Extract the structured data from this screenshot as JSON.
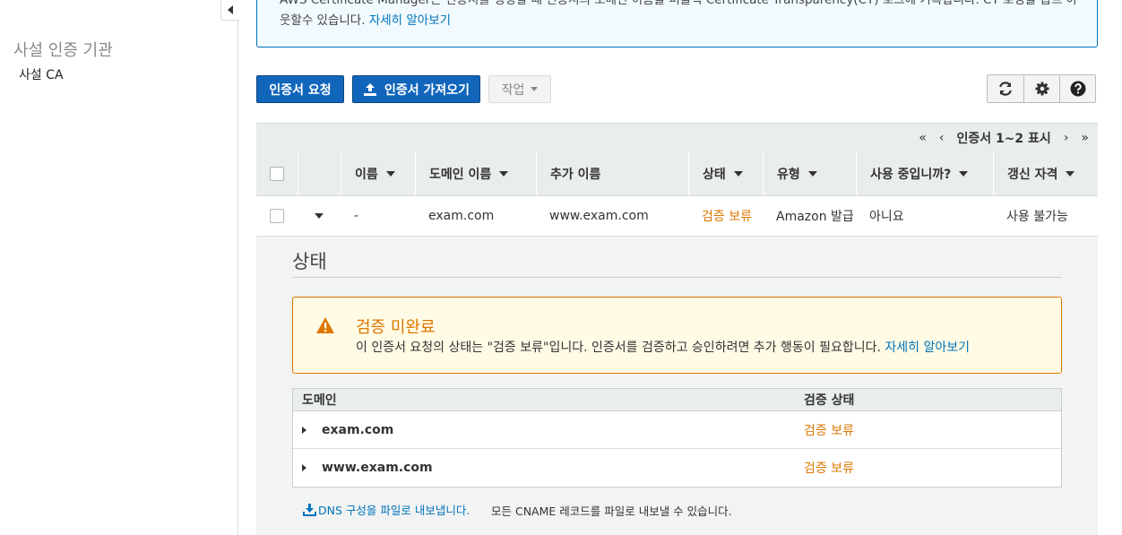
{
  "sidebar": {
    "heading": "사설 인증 기관",
    "items": [
      {
        "label": "사설 CA"
      }
    ]
  },
  "banner": {
    "line1": "AWS Certificate Manager는 인증서를 생성할 때 인증서의 도메인 이름을 퍼블릭 Certificate Transparency(CT) 로그에 기록합니다. CT 로깅을 옵트 아",
    "line2": "웃할수 있습니다.",
    "link": "자세히 알아보기"
  },
  "toolbar": {
    "request_label": "인증서 요청",
    "import_label": "인증서 가져오기",
    "actions_label": "작업",
    "icons": [
      "refresh-icon",
      "gear-icon",
      "help-icon"
    ]
  },
  "pager": {
    "text": "인증서 1~2 표시"
  },
  "table": {
    "columns": [
      "이름",
      "도메인 이름",
      "추가 이름",
      "상태",
      "유형",
      "사용 중입니까?",
      "갱신 자격"
    ],
    "rows": [
      {
        "name": "-",
        "domain": "exam.com",
        "additional": "www.exam.com",
        "status": "검증 보류",
        "type": "Amazon 발급",
        "in_use": "아니요",
        "renewal": "사용 불가능"
      }
    ]
  },
  "details": {
    "title": "상태",
    "warning": {
      "title": "검증 미완료",
      "text": "이 인증서 요청의 상태는 \"검증 보류\"입니다. 인증서를 검증하고 승인하려면 추가 행동이 필요합니다.",
      "link": "자세히 알아보기"
    },
    "domain_table": {
      "headers": [
        "도메인",
        "검증 상태"
      ],
      "rows": [
        {
          "domain": "exam.com",
          "status": "검증 보류"
        },
        {
          "domain": "www.exam.com",
          "status": "검증 보류"
        }
      ]
    },
    "export_link": "DNS 구성을 파일로 내보냅니다.",
    "export_note": "모든 CNAME 레코드를 파일로 내보낼 수 있습니다."
  },
  "colors": {
    "primary": "#1166bb",
    "link": "#0073bb",
    "pending": "#dd7700",
    "warning_bg": "#fffbe5"
  }
}
